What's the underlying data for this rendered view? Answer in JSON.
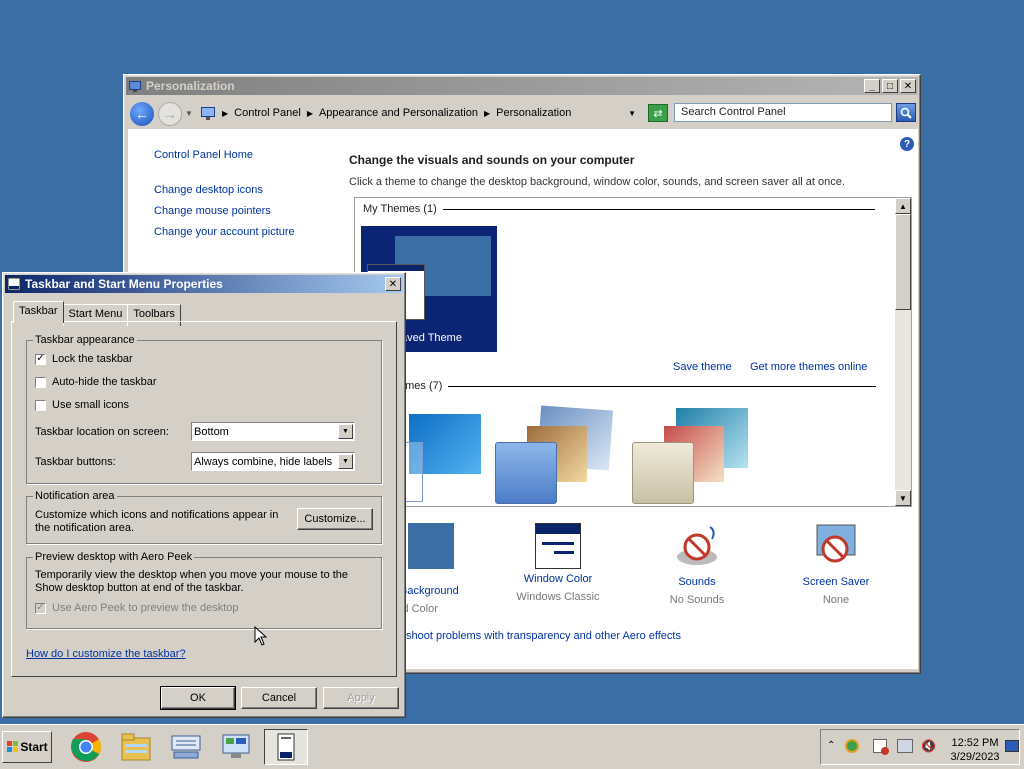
{
  "control_panel": {
    "title": "Personalization",
    "breadcrumb": [
      "Control Panel",
      "Appearance and Personalization",
      "Personalization"
    ],
    "search_placeholder": "Search Control Panel",
    "sidebar": {
      "home": "Control Panel Home",
      "links": [
        "Change desktop icons",
        "Change mouse pointers",
        "Change your account picture"
      ]
    },
    "heading": "Change the visuals and sounds on your computer",
    "description": "Click a theme to change the desktop background, window color, sounds, and screen saver all at once.",
    "my_themes_label": "My Themes (1)",
    "unsaved_theme": "aved Theme",
    "save_theme": "Save theme",
    "get_more_themes": "Get more themes online",
    "aero_themes_label": "emes (7)",
    "bottom": [
      {
        "label": "o Background",
        "sub": "id Color"
      },
      {
        "label": "Window Color",
        "sub": "Windows Classic"
      },
      {
        "label": "Sounds",
        "sub": "No Sounds"
      },
      {
        "label": "Screen Saver",
        "sub": "None"
      }
    ],
    "troubleshoot": "shoot problems with transparency and other Aero effects"
  },
  "taskbar_dialog": {
    "title": "Taskbar and Start Menu Properties",
    "tabs": [
      "Taskbar",
      "Start Menu",
      "Toolbars"
    ],
    "appearance": {
      "title": "Taskbar appearance",
      "lock": "Lock the taskbar",
      "autohide": "Auto-hide the taskbar",
      "small_icons": "Use small icons",
      "location_label": "Taskbar location on screen:",
      "location_value": "Bottom",
      "buttons_label": "Taskbar buttons:",
      "buttons_value": "Always combine, hide labels"
    },
    "notification": {
      "title": "Notification area",
      "text": "Customize which icons and notifications appear in the notification area.",
      "customize": "Customize..."
    },
    "peek": {
      "title": "Preview desktop with Aero Peek",
      "text": "Temporarily view the desktop when you move your mouse to the Show desktop button at end of the taskbar.",
      "checkbox": "Use Aero Peek to preview the desktop"
    },
    "help_link": "How do I customize the taskbar?",
    "ok": "OK",
    "cancel": "Cancel",
    "apply": "Apply"
  },
  "taskbar": {
    "start": "Start",
    "time": "12:52 PM",
    "date": "3/29/2023"
  },
  "colors": {
    "desktop": "#3a6ea5",
    "link": "#0033a0",
    "active_title": "#0a246a"
  }
}
